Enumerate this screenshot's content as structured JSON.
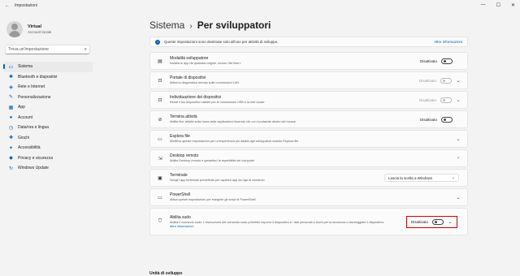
{
  "window": {
    "back": "←",
    "title": "Impostazioni",
    "minimize": "—",
    "maximize": "☐",
    "close": "✕"
  },
  "profile": {
    "name": "Virtual",
    "account": "Account locale"
  },
  "search": {
    "placeholder": "Trova un'impostazione",
    "icon": "search-icon"
  },
  "nav": [
    {
      "label": "Sistema",
      "icon": "system-icon",
      "glyph": "▭",
      "active": true
    },
    {
      "label": "Bluetooth e dispositivi",
      "icon": "bluetooth-icon",
      "glyph": "✱"
    },
    {
      "label": "Rete e Internet",
      "icon": "wifi-icon",
      "glyph": "◈"
    },
    {
      "label": "Personalizzazione",
      "icon": "brush-icon",
      "glyph": "✎"
    },
    {
      "label": "App",
      "icon": "apps-icon",
      "glyph": "▦"
    },
    {
      "label": "Account",
      "icon": "account-icon",
      "glyph": "●"
    },
    {
      "label": "Data/ora e lingua",
      "icon": "clock-globe-icon",
      "glyph": "◷"
    },
    {
      "label": "Giochi",
      "icon": "gamepad-icon",
      "glyph": "✚"
    },
    {
      "label": "Accessibilità",
      "icon": "accessibility-icon",
      "glyph": "✦"
    },
    {
      "label": "Privacy e sicurezza",
      "icon": "shield-icon",
      "glyph": "◆"
    },
    {
      "label": "Windows Update",
      "icon": "update-icon",
      "glyph": "↻"
    }
  ],
  "breadcrumb": {
    "parent": "Sistema",
    "separator": "›",
    "current": "Per sviluppatori"
  },
  "info": {
    "text": "Queste impostazioni sono destinate solo all'uso per attività di sviluppo.",
    "link": "Altre informazioni"
  },
  "settings": [
    {
      "title": "Modalità sviluppatore",
      "desc": "Installa le app da qualsiasi origine, inclusi i file liberi.",
      "state": "Disattivato",
      "control": "toggle",
      "icon": "code-icon",
      "glyph": "▤"
    },
    {
      "title": "Portale di dispositivi",
      "desc": "Attiva la diagnostica remota sulle connessioni LAN",
      "state": "Disattivato",
      "control": "toggle-expand",
      "disabled": true,
      "icon": "portal-icon",
      "glyph": "⊡"
    },
    {
      "title": "Individuazione dei dispositivi",
      "desc": "Rendi il tuo dispositivo visibile per le connessioni USB e la rete locale",
      "state": "Disattivato",
      "control": "toggle-expand",
      "disabled": true,
      "icon": "device-discovery-icon",
      "glyph": "⊡"
    },
    {
      "title": "Termina attività",
      "desc": "Abilita fine attività sulla barra delle applicazioni facendo clic con il pulsante destro del mouse",
      "state": "Disattivato",
      "control": "toggle",
      "icon": "end-task-icon",
      "glyph": "⊘"
    },
    {
      "title": "Esplora file",
      "desc": "Modifica queste impostazioni per un'esperienza più adatta agli sviluppatori usando Esplora file",
      "control": "expand",
      "icon": "folder-icon",
      "glyph": "▭"
    },
    {
      "title": "Desktop remoto",
      "desc": "Abilita Desktop remoto e garantisci la reperibilità del computer",
      "control": "link",
      "icon": "remote-desktop-icon",
      "glyph": "⇲"
    },
    {
      "title": "Terminale",
      "desc": "Scegli l'app terminale predefinita per ospitare app da riga di comando",
      "select": "Lascia la scelta a Windows",
      "control": "select",
      "icon": "terminal-icon",
      "glyph": "▣"
    },
    {
      "title": "PowerShell",
      "desc": "Attiva queste impostazioni per eseguire gli script di PowerShell",
      "control": "expand",
      "icon": "powershell-icon",
      "glyph": "▭"
    },
    {
      "title": "Abilita sudo",
      "desc": "Abilita il comando sudo. L'esecuzione del comando sudo potrebbe esporre il dispositivo e i dati personali a rischi per la sicurezza o danneggiare il dispositivo.",
      "link": "Altre informazioni",
      "state": "Disattivato",
      "control": "toggle-expand",
      "highlighted": true,
      "icon": "shield-outline-icon",
      "glyph": "⛉"
    }
  ],
  "section": {
    "label": "Unità di sviluppo"
  },
  "glyphs": {
    "chevron_down": "⌄",
    "chevron_right": "›",
    "search": "⌕",
    "info": "i"
  },
  "colors": {
    "accent": "#005fb8",
    "highlight_box": "#cc0000",
    "background": "#f3f3f3"
  }
}
